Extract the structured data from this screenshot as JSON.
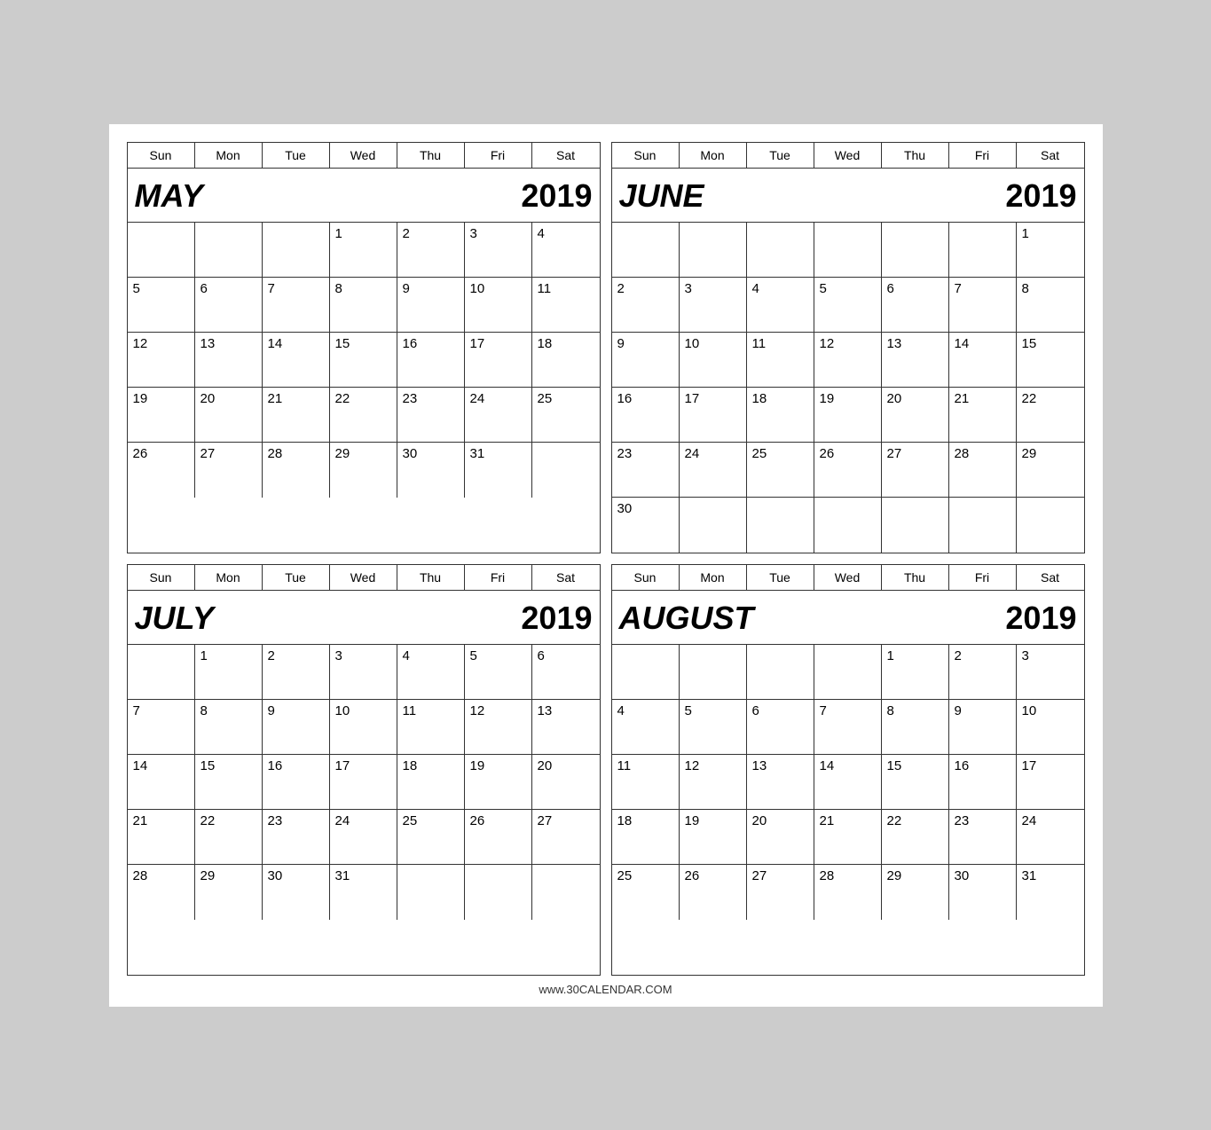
{
  "footer": "www.30CALENDAR.COM",
  "dayNames": [
    "Sun",
    "Mon",
    "Tue",
    "Wed",
    "Thu",
    "Fri",
    "Sat"
  ],
  "calendars": [
    {
      "id": "may-2019",
      "month": "MAY",
      "year": "2019",
      "startDay": 3,
      "totalDays": 31,
      "rows": 6
    },
    {
      "id": "june-2019",
      "month": "JUNE",
      "year": "2019",
      "startDay": 6,
      "totalDays": 30,
      "rows": 6
    },
    {
      "id": "july-2019",
      "month": "JULY",
      "year": "2019",
      "startDay": 1,
      "totalDays": 31,
      "rows": 5
    },
    {
      "id": "august-2019",
      "month": "AUGUST",
      "year": "2019",
      "startDay": 4,
      "totalDays": 31,
      "rows": 5
    }
  ]
}
